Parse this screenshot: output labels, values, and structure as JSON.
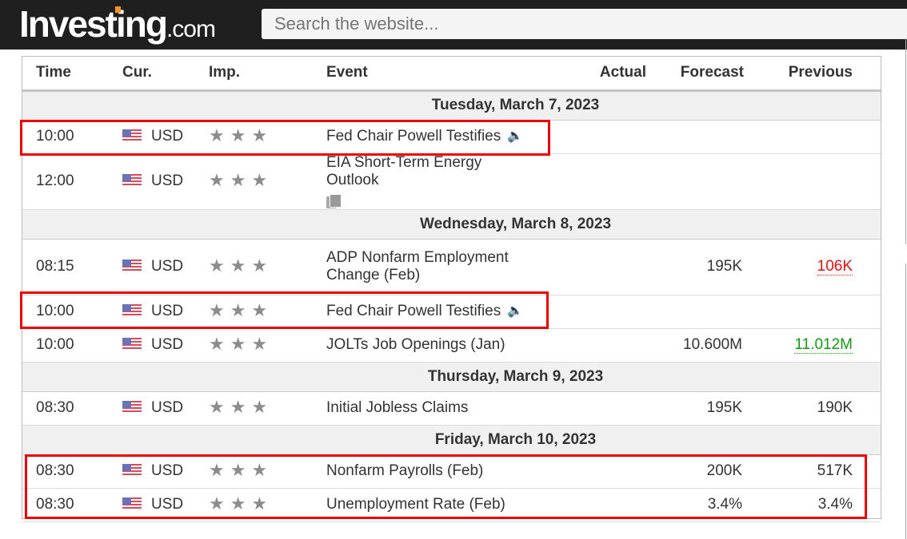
{
  "header": {
    "logo_main": "Investing",
    "logo_suffix": ".com",
    "search_placeholder": "Search the website..."
  },
  "table": {
    "columns": [
      "Time",
      "Cur.",
      "Imp.",
      "Event",
      "Actual",
      "Forecast",
      "Previous"
    ],
    "days": [
      {
        "date": "Tuesday, March 7, 2023",
        "events": [
          {
            "time": "10:00",
            "currency": "USD",
            "importance": 3,
            "event": "Fed Chair Powell Testifies",
            "icon": "speaker-icon",
            "actual": "",
            "forecast": "",
            "previous": "",
            "highlighted": true
          },
          {
            "time": "12:00",
            "currency": "USD",
            "importance": 3,
            "event": "EIA Short-Term Energy Outlook",
            "icon": "report-icon",
            "actual": "",
            "forecast": "",
            "previous": ""
          }
        ]
      },
      {
        "date": "Wednesday, March 8, 2023",
        "events": [
          {
            "time": "08:15",
            "currency": "USD",
            "importance": 3,
            "event": "ADP Nonfarm Employment Change (Feb)",
            "actual": "",
            "forecast": "195K",
            "previous": "106K",
            "previous_color": "#e81010"
          },
          {
            "time": "10:00",
            "currency": "USD",
            "importance": 3,
            "event": "Fed Chair Powell Testifies",
            "icon": "speaker-icon",
            "actual": "",
            "forecast": "",
            "previous": "",
            "highlighted": true
          },
          {
            "time": "10:00",
            "currency": "USD",
            "importance": 3,
            "event": "JOLTs Job Openings (Jan)",
            "actual": "",
            "forecast": "10.600M",
            "previous": "11.012M",
            "previous_color": "#139a13"
          }
        ]
      },
      {
        "date": "Thursday, March 9, 2023",
        "events": [
          {
            "time": "08:30",
            "currency": "USD",
            "importance": 3,
            "event": "Initial Jobless Claims",
            "actual": "",
            "forecast": "195K",
            "previous": "190K"
          }
        ]
      },
      {
        "date": "Friday, March 10, 2023",
        "events": [
          {
            "time": "08:30",
            "currency": "USD",
            "importance": 3,
            "event": "Nonfarm Payrolls (Feb)",
            "actual": "",
            "forecast": "200K",
            "previous": "517K",
            "highlighted": true
          },
          {
            "time": "08:30",
            "currency": "USD",
            "importance": 3,
            "event": "Unemployment Rate (Feb)",
            "actual": "",
            "forecast": "3.4%",
            "previous": "3.4%",
            "highlighted": true
          }
        ]
      }
    ]
  },
  "colors": {
    "highlight_box": "#ee0000",
    "worse_than_expected": "#e81010",
    "better_than_expected": "#139a13",
    "logo_accent": "#f7941d"
  }
}
